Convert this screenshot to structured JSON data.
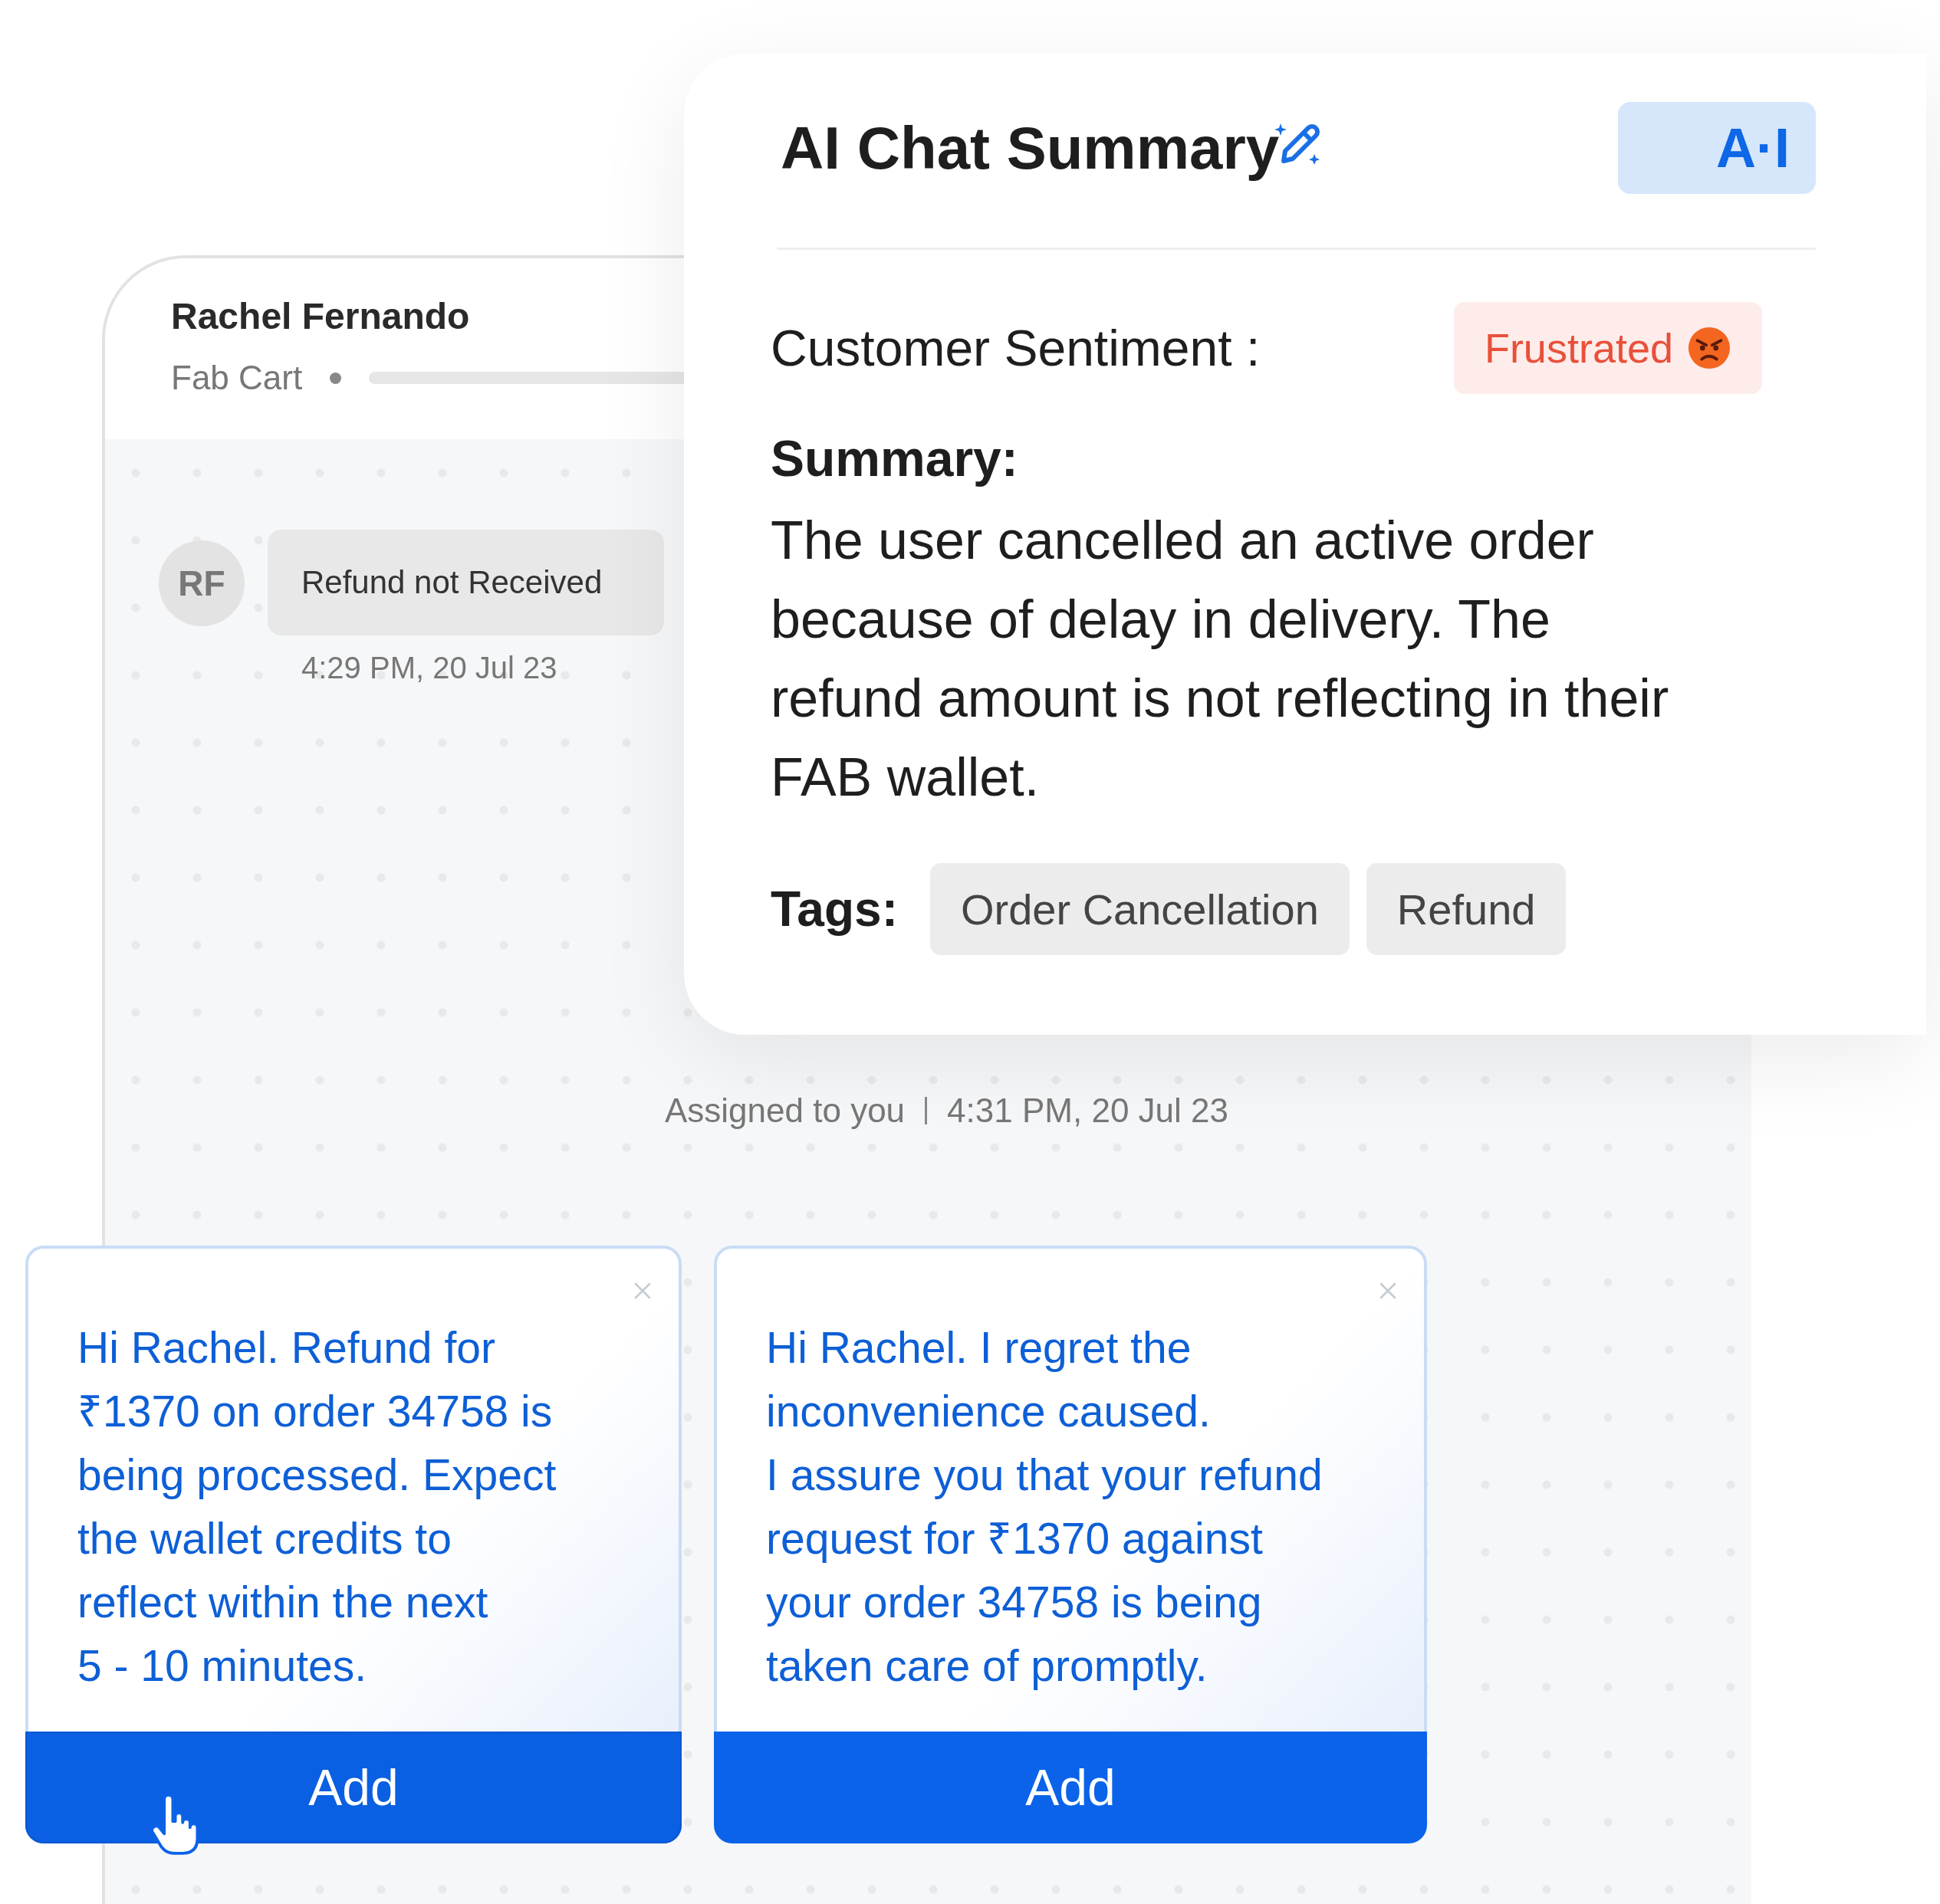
{
  "chat": {
    "contact_name": "Rachel Fernando",
    "store": "Fab Cart",
    "avatar_initials": "RF",
    "messages": [
      {
        "text": "Refund not Received",
        "time": "4:29 PM,  20 Jul 23"
      }
    ],
    "system_note": {
      "text": "Assigned to you",
      "time": "4:31 PM,  20 Jul 23"
    }
  },
  "summary": {
    "title": "AI Chat Summary",
    "badge": "A·I",
    "sentiment_label": "Customer Sentiment :",
    "sentiment": "Frustrated",
    "summary_label": "Summary:",
    "summary_text": "The user cancelled an active order\nbecause of delay in delivery. The\nrefund amount is not reflecting in their\nFAB wallet.",
    "tags_label": "Tags:",
    "tags": [
      "Order Cancellation",
      "Refund"
    ]
  },
  "suggestions": [
    {
      "text": "Hi Rachel. Refund for\n₹1370 on order 34758 is\nbeing processed. Expect\nthe wallet credits to\nreflect within the next\n5 - 10 minutes.",
      "button": "Add",
      "hovered": true
    },
    {
      "text": "Hi Rachel. I regret the\ninconvenience caused.\nI assure you that your refund\nrequest for ₹1370 against\nyour order 34758 is being\ntaken care of promptly.",
      "button": "Add",
      "hovered": false
    }
  ]
}
